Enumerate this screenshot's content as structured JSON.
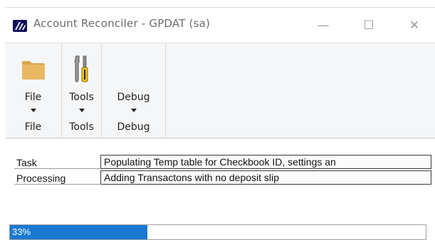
{
  "window": {
    "title": "Account Reconciler  -  GPDAT (sa)",
    "logo_icon": "gp-logo-icon",
    "controls": {
      "minimize": "—",
      "maximize": "☐",
      "close": "✕"
    }
  },
  "ribbon": {
    "groups": [
      {
        "button_label": "File",
        "group_label": "File",
        "icon": "folder-icon"
      },
      {
        "button_label": "Tools",
        "group_label": "Tools",
        "icon": "tools-icon"
      },
      {
        "button_label": "Debug",
        "group_label": "Debug",
        "icon": ""
      }
    ]
  },
  "status": {
    "rows": [
      {
        "label": "Task",
        "value": "Populating Temp table for Checkbook ID, settings an"
      },
      {
        "label": "Processing",
        "value": "Adding Transactons with no deposit slip"
      }
    ]
  },
  "progress": {
    "text": "33%",
    "value": 0.33
  },
  "colors": {
    "progress_fill": "#1979d1",
    "folder": "#e8b862",
    "logo_bg": "#12125a"
  }
}
